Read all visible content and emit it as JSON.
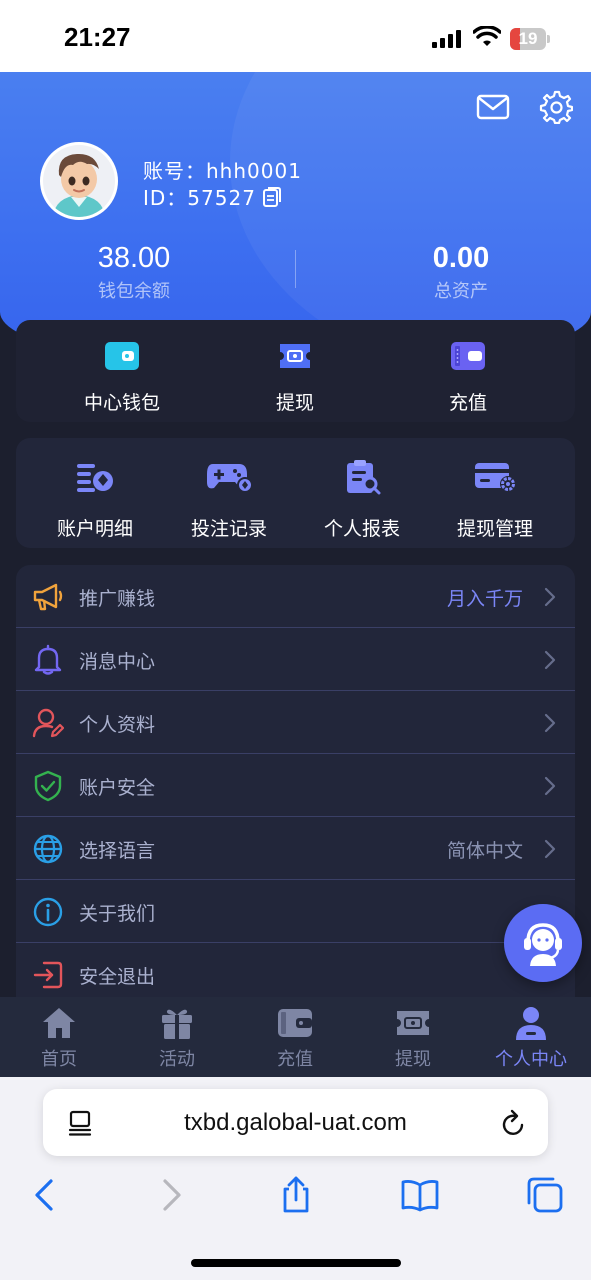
{
  "status_bar": {
    "time": "21:27",
    "battery": "19"
  },
  "profile": {
    "account": "账号：hhh0001",
    "id": "ID：57527",
    "wallet_balance": "38.00",
    "wallet_balance_label": "钱包余额",
    "total_assets": "0.00",
    "total_assets_label": "总资产"
  },
  "quick_actions": [
    {
      "label": "中心钱包",
      "icon": "wallet-icon"
    },
    {
      "label": "提现",
      "icon": "withdraw-ticket-icon"
    },
    {
      "label": "充值",
      "icon": "deposit-card-icon"
    }
  ],
  "shortcuts": [
    {
      "label": "账户明细",
      "icon": "account-detail-icon"
    },
    {
      "label": "投注记录",
      "icon": "gamepad-icon"
    },
    {
      "label": "个人报表",
      "icon": "report-clipboard-icon"
    },
    {
      "label": "提现管理",
      "icon": "card-settings-icon"
    }
  ],
  "menu": [
    {
      "label": "推广赚钱",
      "value": "月入千万",
      "icon": "megaphone-icon",
      "value_color": "#7b86f7"
    },
    {
      "label": "消息中心",
      "value": "",
      "icon": "bell-icon"
    },
    {
      "label": "个人资料",
      "value": "",
      "icon": "user-edit-icon"
    },
    {
      "label": "账户安全",
      "value": "",
      "icon": "shield-check-icon"
    },
    {
      "label": "选择语言",
      "value": "简体中文",
      "icon": "globe-icon",
      "value_color": "#8a92b2"
    },
    {
      "label": "关于我们",
      "value": "",
      "icon": "info-icon"
    },
    {
      "label": "安全退出",
      "value": "",
      "icon": "logout-icon"
    }
  ],
  "tabbar": [
    {
      "label": "首页",
      "icon": "home-icon"
    },
    {
      "label": "活动",
      "icon": "gift-icon"
    },
    {
      "label": "充值",
      "icon": "wallet-icon"
    },
    {
      "label": "提现",
      "icon": "withdraw-ticket-icon"
    },
    {
      "label": "个人中心",
      "icon": "person-icon",
      "active": true
    }
  ],
  "browser": {
    "url": "txbd.galobal-uat.com"
  },
  "colors": {
    "accent": "#4a7ff0",
    "active_tab": "#7b86f7",
    "background": "#1c1f2e"
  }
}
